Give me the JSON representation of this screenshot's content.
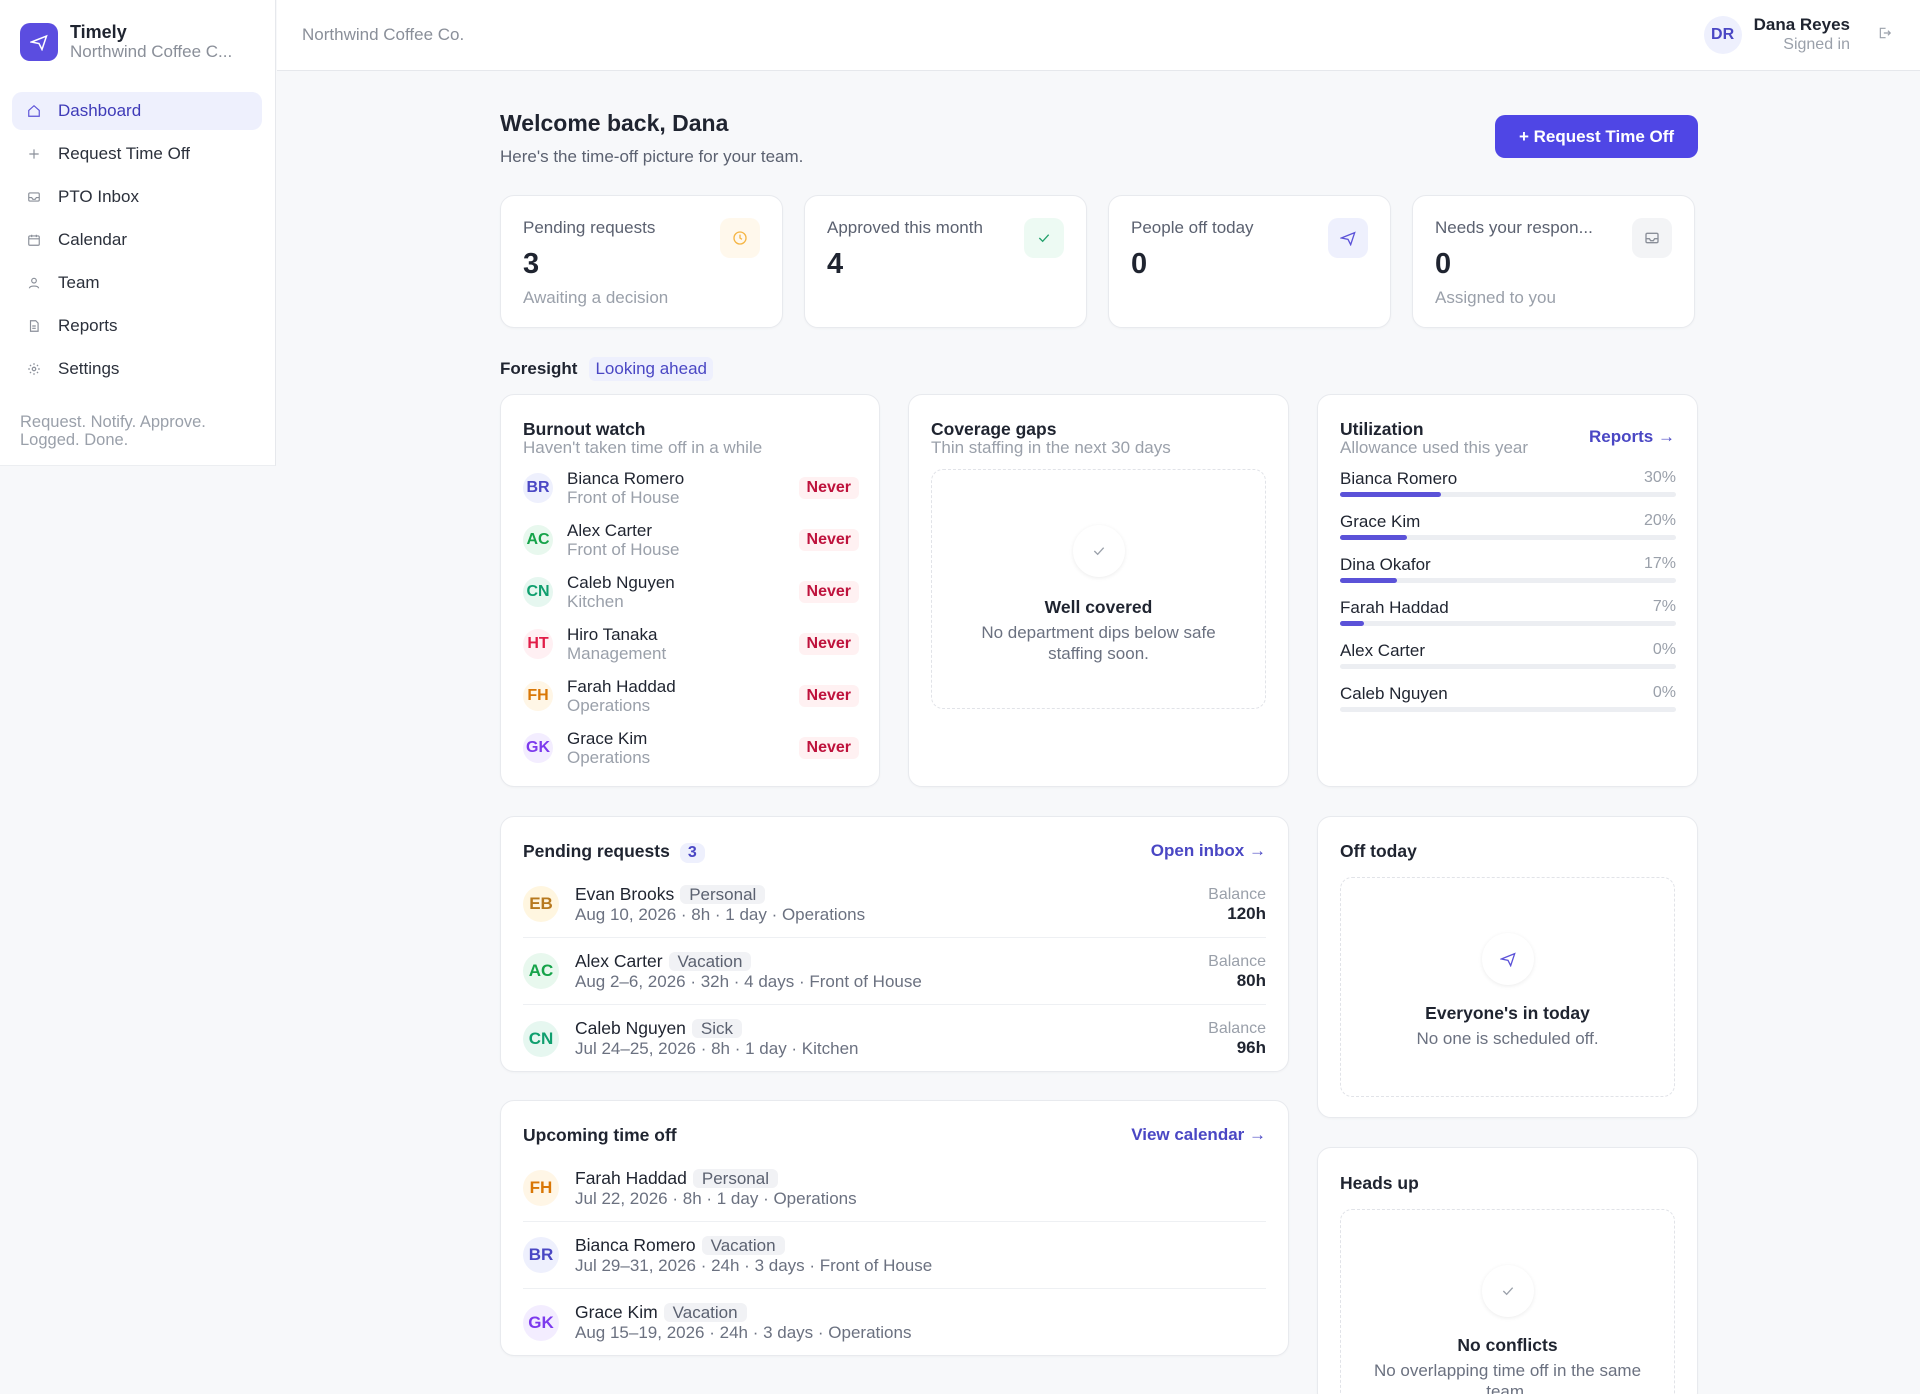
{
  "app": {
    "name": "Timely",
    "org": "Northwind Coffee C...",
    "tagline": "Request. Notify. Approve. Logged. Done."
  },
  "nav": [
    {
      "label": "Dashboard",
      "icon": "home-icon",
      "active": true
    },
    {
      "label": "Request Time Off",
      "icon": "plus-icon"
    },
    {
      "label": "PTO Inbox",
      "icon": "inbox-icon"
    },
    {
      "label": "Calendar",
      "icon": "calendar-icon"
    },
    {
      "label": "Team",
      "icon": "user-icon"
    },
    {
      "label": "Reports",
      "icon": "document-icon"
    },
    {
      "label": "Settings",
      "icon": "gear-icon"
    }
  ],
  "topbar": {
    "title": "Northwind Coffee Co."
  },
  "user": {
    "initials": "DR",
    "name": "Dana Reyes",
    "status": "Signed in"
  },
  "header": {
    "welcome": "Welcome back, Dana",
    "subtitle": "Here's the time-off picture for your team.",
    "request_button": "+ Request Time Off"
  },
  "stats": [
    {
      "label": "Pending requests",
      "value": "3",
      "sub": "Awaiting a decision",
      "icon": "clock-icon",
      "color": "#f5b544",
      "bg": "#fff8ec"
    },
    {
      "label": "Approved this month",
      "value": "4",
      "sub": "",
      "icon": "check-icon",
      "color": "#22a06b",
      "bg": "#edfaf3"
    },
    {
      "label": "People off today",
      "value": "0",
      "sub": "",
      "icon": "plane-icon",
      "color": "#5b52d8",
      "bg": "#eef0fd"
    },
    {
      "label": "Needs your respon...",
      "value": "0",
      "sub": "Assigned to you",
      "icon": "inbox-icon",
      "color": "#8a8f99",
      "bg": "#f3f4f6"
    }
  ],
  "foresight": {
    "title": "Foresight",
    "badge": "Looking ahead"
  },
  "burnout": {
    "title": "Burnout watch",
    "subtitle": "Haven't taken time off in a while",
    "people": [
      {
        "initials": "BR",
        "name": "Bianca Romero",
        "dept": "Front of House",
        "status": "Never",
        "fg": "#4a47c4",
        "bg": "#eef0fd"
      },
      {
        "initials": "AC",
        "name": "Alex Carter",
        "dept": "Front of House",
        "status": "Never",
        "fg": "#16a34a",
        "bg": "#e8f8ee"
      },
      {
        "initials": "CN",
        "name": "Caleb Nguyen",
        "dept": "Kitchen",
        "status": "Never",
        "fg": "#0f9f6e",
        "bg": "#e6f7f0"
      },
      {
        "initials": "HT",
        "name": "Hiro Tanaka",
        "dept": "Management",
        "status": "Never",
        "fg": "#e11d48",
        "bg": "#fff0f3"
      },
      {
        "initials": "FH",
        "name": "Farah Haddad",
        "dept": "Operations",
        "status": "Never",
        "fg": "#d97706",
        "bg": "#fff6e6"
      },
      {
        "initials": "GK",
        "name": "Grace Kim",
        "dept": "Operations",
        "status": "Never",
        "fg": "#7c3aed",
        "bg": "#f3edff"
      }
    ]
  },
  "coverage": {
    "title": "Coverage gaps",
    "subtitle": "Thin staffing in the next 30 days",
    "empty_title": "Well covered",
    "empty_sub": "No department dips below safe staffing soon."
  },
  "utilization": {
    "title": "Utilization",
    "subtitle": "Allowance used this year",
    "link": "Reports →",
    "people": [
      {
        "name": "Bianca Romero",
        "pct_label": "30%",
        "pct": 30
      },
      {
        "name": "Grace Kim",
        "pct_label": "20%",
        "pct": 20
      },
      {
        "name": "Dina Okafor",
        "pct_label": "17%",
        "pct": 17
      },
      {
        "name": "Farah Haddad",
        "pct_label": "7%",
        "pct": 7
      },
      {
        "name": "Alex Carter",
        "pct_label": "0%",
        "pct": 0
      },
      {
        "name": "Caleb Nguyen",
        "pct_label": "0%",
        "pct": 0
      }
    ]
  },
  "pending": {
    "title": "Pending requests",
    "count": "3",
    "link": "Open inbox →",
    "balance_label": "Balance",
    "items": [
      {
        "initials": "EB",
        "name": "Evan Brooks",
        "type": "Personal",
        "meta": "Aug 10, 2026 · 8h · 1 day · Operations",
        "balance": "120h",
        "fg": "#b7791f",
        "bg": "#fff6e0"
      },
      {
        "initials": "AC",
        "name": "Alex Carter",
        "type": "Vacation",
        "meta": "Aug 2–6, 2026 · 32h · 4 days · Front of House",
        "balance": "80h",
        "fg": "#16a34a",
        "bg": "#e8f8ee"
      },
      {
        "initials": "CN",
        "name": "Caleb Nguyen",
        "type": "Sick",
        "meta": "Jul 24–25, 2026 · 8h · 1 day · Kitchen",
        "balance": "96h",
        "fg": "#0f9f6e",
        "bg": "#e6f7f0"
      }
    ]
  },
  "upcoming": {
    "title": "Upcoming time off",
    "link": "View calendar →",
    "items": [
      {
        "initials": "FH",
        "name": "Farah Haddad",
        "type": "Personal",
        "meta": "Jul 22, 2026 · 8h · 1 day · Operations",
        "fg": "#d97706",
        "bg": "#fff6e6"
      },
      {
        "initials": "BR",
        "name": "Bianca Romero",
        "type": "Vacation",
        "meta": "Jul 29–31, 2026 · 24h · 3 days · Front of House",
        "fg": "#4a47c4",
        "bg": "#eef0fd"
      },
      {
        "initials": "GK",
        "name": "Grace Kim",
        "type": "Vacation",
        "meta": "Aug 15–19, 2026 · 24h · 3 days · Operations",
        "fg": "#7c3aed",
        "bg": "#f3edff"
      }
    ]
  },
  "off_today": {
    "title": "Off today",
    "empty_title": "Everyone's in today",
    "empty_sub": "No one is scheduled off."
  },
  "heads_up": {
    "title": "Heads up",
    "empty_title": "No conflicts",
    "empty_sub": "No overlapping time off in the same team."
  }
}
